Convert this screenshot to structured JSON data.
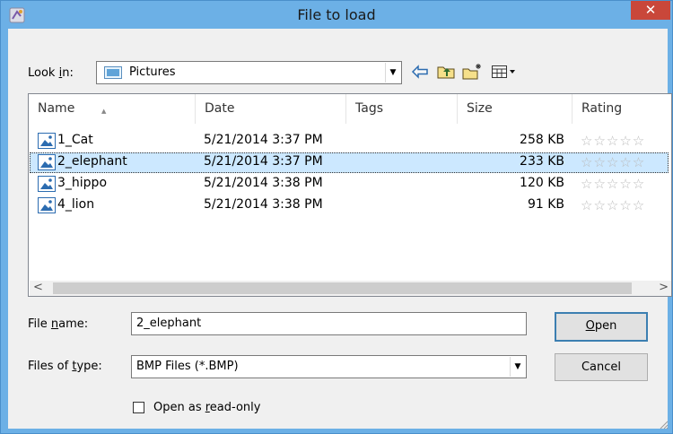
{
  "window": {
    "title": "File to load",
    "close_label": "✕"
  },
  "toolbar": {
    "look_in_label_pre": "Look ",
    "look_in_label_accel": "i",
    "look_in_label_post": "n:",
    "look_in_value": "Pictures",
    "icons": [
      "back-arrow-icon",
      "up-folder-icon",
      "new-folder-icon",
      "view-menu-icon"
    ]
  },
  "filelist": {
    "columns": [
      "Name",
      "Date",
      "Tags",
      "Size",
      "Rating"
    ],
    "rows": [
      {
        "name": "1_Cat",
        "date": "5/21/2014 3:37 PM",
        "tags": "",
        "size": "258 KB",
        "rating": "☆☆☆☆☆"
      },
      {
        "name": "2_elephant",
        "date": "5/21/2014 3:37 PM",
        "tags": "",
        "size": "233 KB",
        "rating": "☆☆☆☆☆"
      },
      {
        "name": "3_hippo",
        "date": "5/21/2014 3:38 PM",
        "tags": "",
        "size": "120 KB",
        "rating": "☆☆☆☆☆"
      },
      {
        "name": "4_lion",
        "date": "5/21/2014 3:38 PM",
        "tags": "",
        "size": "91 KB",
        "rating": "☆☆☆☆☆"
      }
    ],
    "selected_index": 1
  },
  "form": {
    "file_name_label_pre": "File ",
    "file_name_label_accel": "n",
    "file_name_label_post": "ame:",
    "file_name_value": "2_elephant",
    "file_type_label_pre": "Files of ",
    "file_type_label_accel": "t",
    "file_type_label_post": "ype:",
    "file_type_value": "BMP Files (*.BMP)",
    "open_label_accel": "O",
    "open_label_rest": "pen",
    "cancel_label": "Cancel",
    "readonly_label_pre": "Open as ",
    "readonly_label_accel": "r",
    "readonly_label_post": "ead-only",
    "readonly_checked": false
  },
  "colors": {
    "titlebar": "#6cb0e6",
    "close": "#c9473a",
    "selection": "#cce8ff"
  }
}
